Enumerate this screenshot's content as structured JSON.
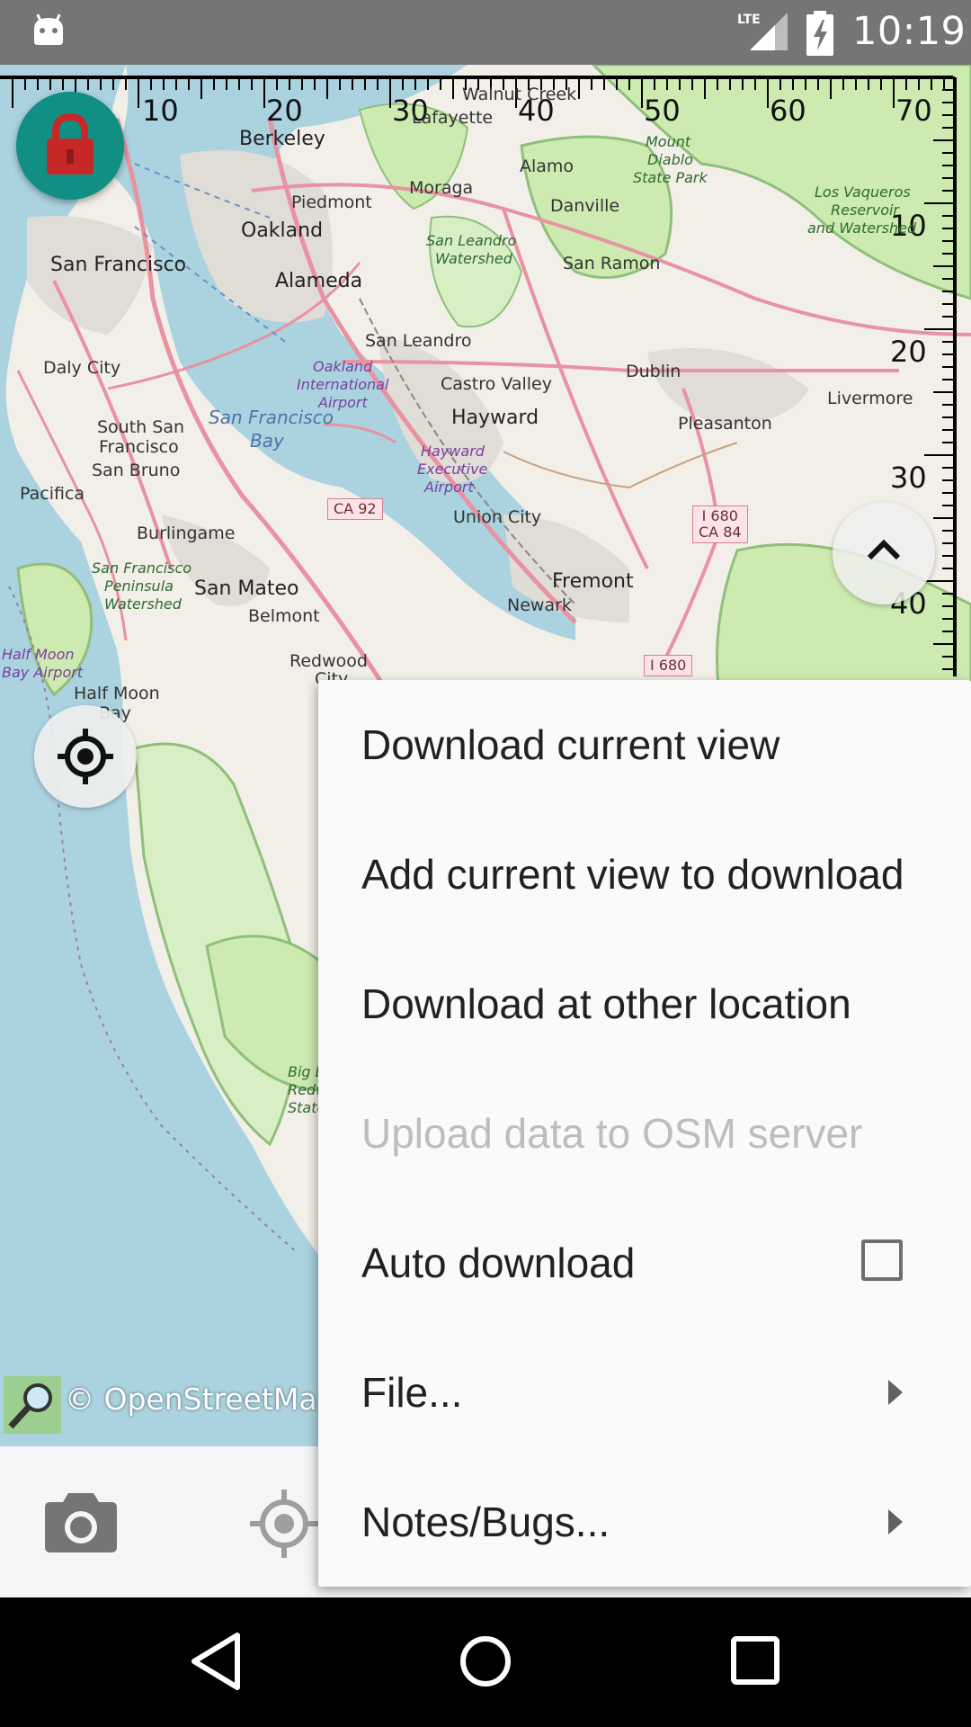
{
  "status_bar": {
    "time": "10:19",
    "network": "LTE",
    "icons": [
      "android-icon",
      "lte-signal-icon",
      "battery-charging-icon"
    ]
  },
  "map": {
    "attribution": "© OpenStreetMap",
    "scale_top": [
      "10",
      "20",
      "30",
      "40",
      "50",
      "60",
      "70"
    ],
    "scale_right": [
      "10",
      "20",
      "30",
      "40"
    ],
    "places": {
      "berkeley": "Berkeley",
      "piedmont": "Piedmont",
      "oakland": "Oakland",
      "moraga": "Moraga",
      "alamo": "Alamo",
      "danville": "Danville",
      "lafayette": "Lafayette",
      "walnut_creek": "Walnut Creek",
      "san_francisco": "San Francisco",
      "alameda": "Alameda",
      "san_ramon": "San Ramon",
      "san_leandro": "San Leandro",
      "castro_valley": "Castro Valley",
      "dublin": "Dublin",
      "livermore": "Livermore",
      "daly_city": "Daly City",
      "hayward": "Hayward",
      "pleasanton": "Pleasanton",
      "south_sf1": "South San",
      "south_sf2": "Francisco",
      "san_bruno": "San Bruno",
      "pacifica": "Pacifica",
      "union_city": "Union City",
      "burlingame": "Burlingame",
      "fremont": "Fremont",
      "newark": "Newark",
      "san_mateo": "San Mateo",
      "belmont": "Belmont",
      "redwood": "Redwood",
      "city": "City",
      "half_moon1": "Half Moon",
      "half_moon2": "Bay"
    },
    "water": {
      "sf_bay1": "San Francisco",
      "sf_bay2": "Bay"
    },
    "parks": {
      "mt_diablo1": "Mount",
      "mt_diablo2": "Diablo",
      "mt_diablo3": "State Park",
      "vaqueros1": "Los Vaqueros",
      "vaqueros2": "Reservoir",
      "vaqueros3": "and Watershed",
      "sl_water1": "San Leandro",
      "sl_water2": "Watershed",
      "sfp1": "San Francisco",
      "sfp2": "Peninsula",
      "sfp3": "Watershed",
      "big1": "Big B",
      "big2": "Redw",
      "big3": "State"
    },
    "airports": {
      "oak1": "Oakland",
      "oak2": "International",
      "oak3": "Airport",
      "hay1": "Hayward",
      "hay2": "Executive",
      "hay3": "Airport",
      "hmb1": "Half Moon",
      "hmb2": "Bay Airport"
    },
    "shields": {
      "ca92": "CA 92",
      "i680_ca84_1": "I 680",
      "i680_ca84_2": "CA 84",
      "i680": "I 680"
    }
  },
  "menu": {
    "items": [
      {
        "label": "Download current view",
        "enabled": true
      },
      {
        "label": "Add current view to download",
        "enabled": true
      },
      {
        "label": "Download at other location",
        "enabled": true
      },
      {
        "label": "Upload data to OSM server",
        "enabled": false
      },
      {
        "label": "Auto download",
        "enabled": true,
        "checkbox": false
      },
      {
        "label": "File...",
        "enabled": true,
        "submenu": true
      },
      {
        "label": "Notes/Bugs...",
        "enabled": true,
        "submenu": true
      }
    ]
  },
  "colors": {
    "accent": "#118f85",
    "lock": "#c62828",
    "water": "#aad3df",
    "land": "#f2efe9"
  }
}
